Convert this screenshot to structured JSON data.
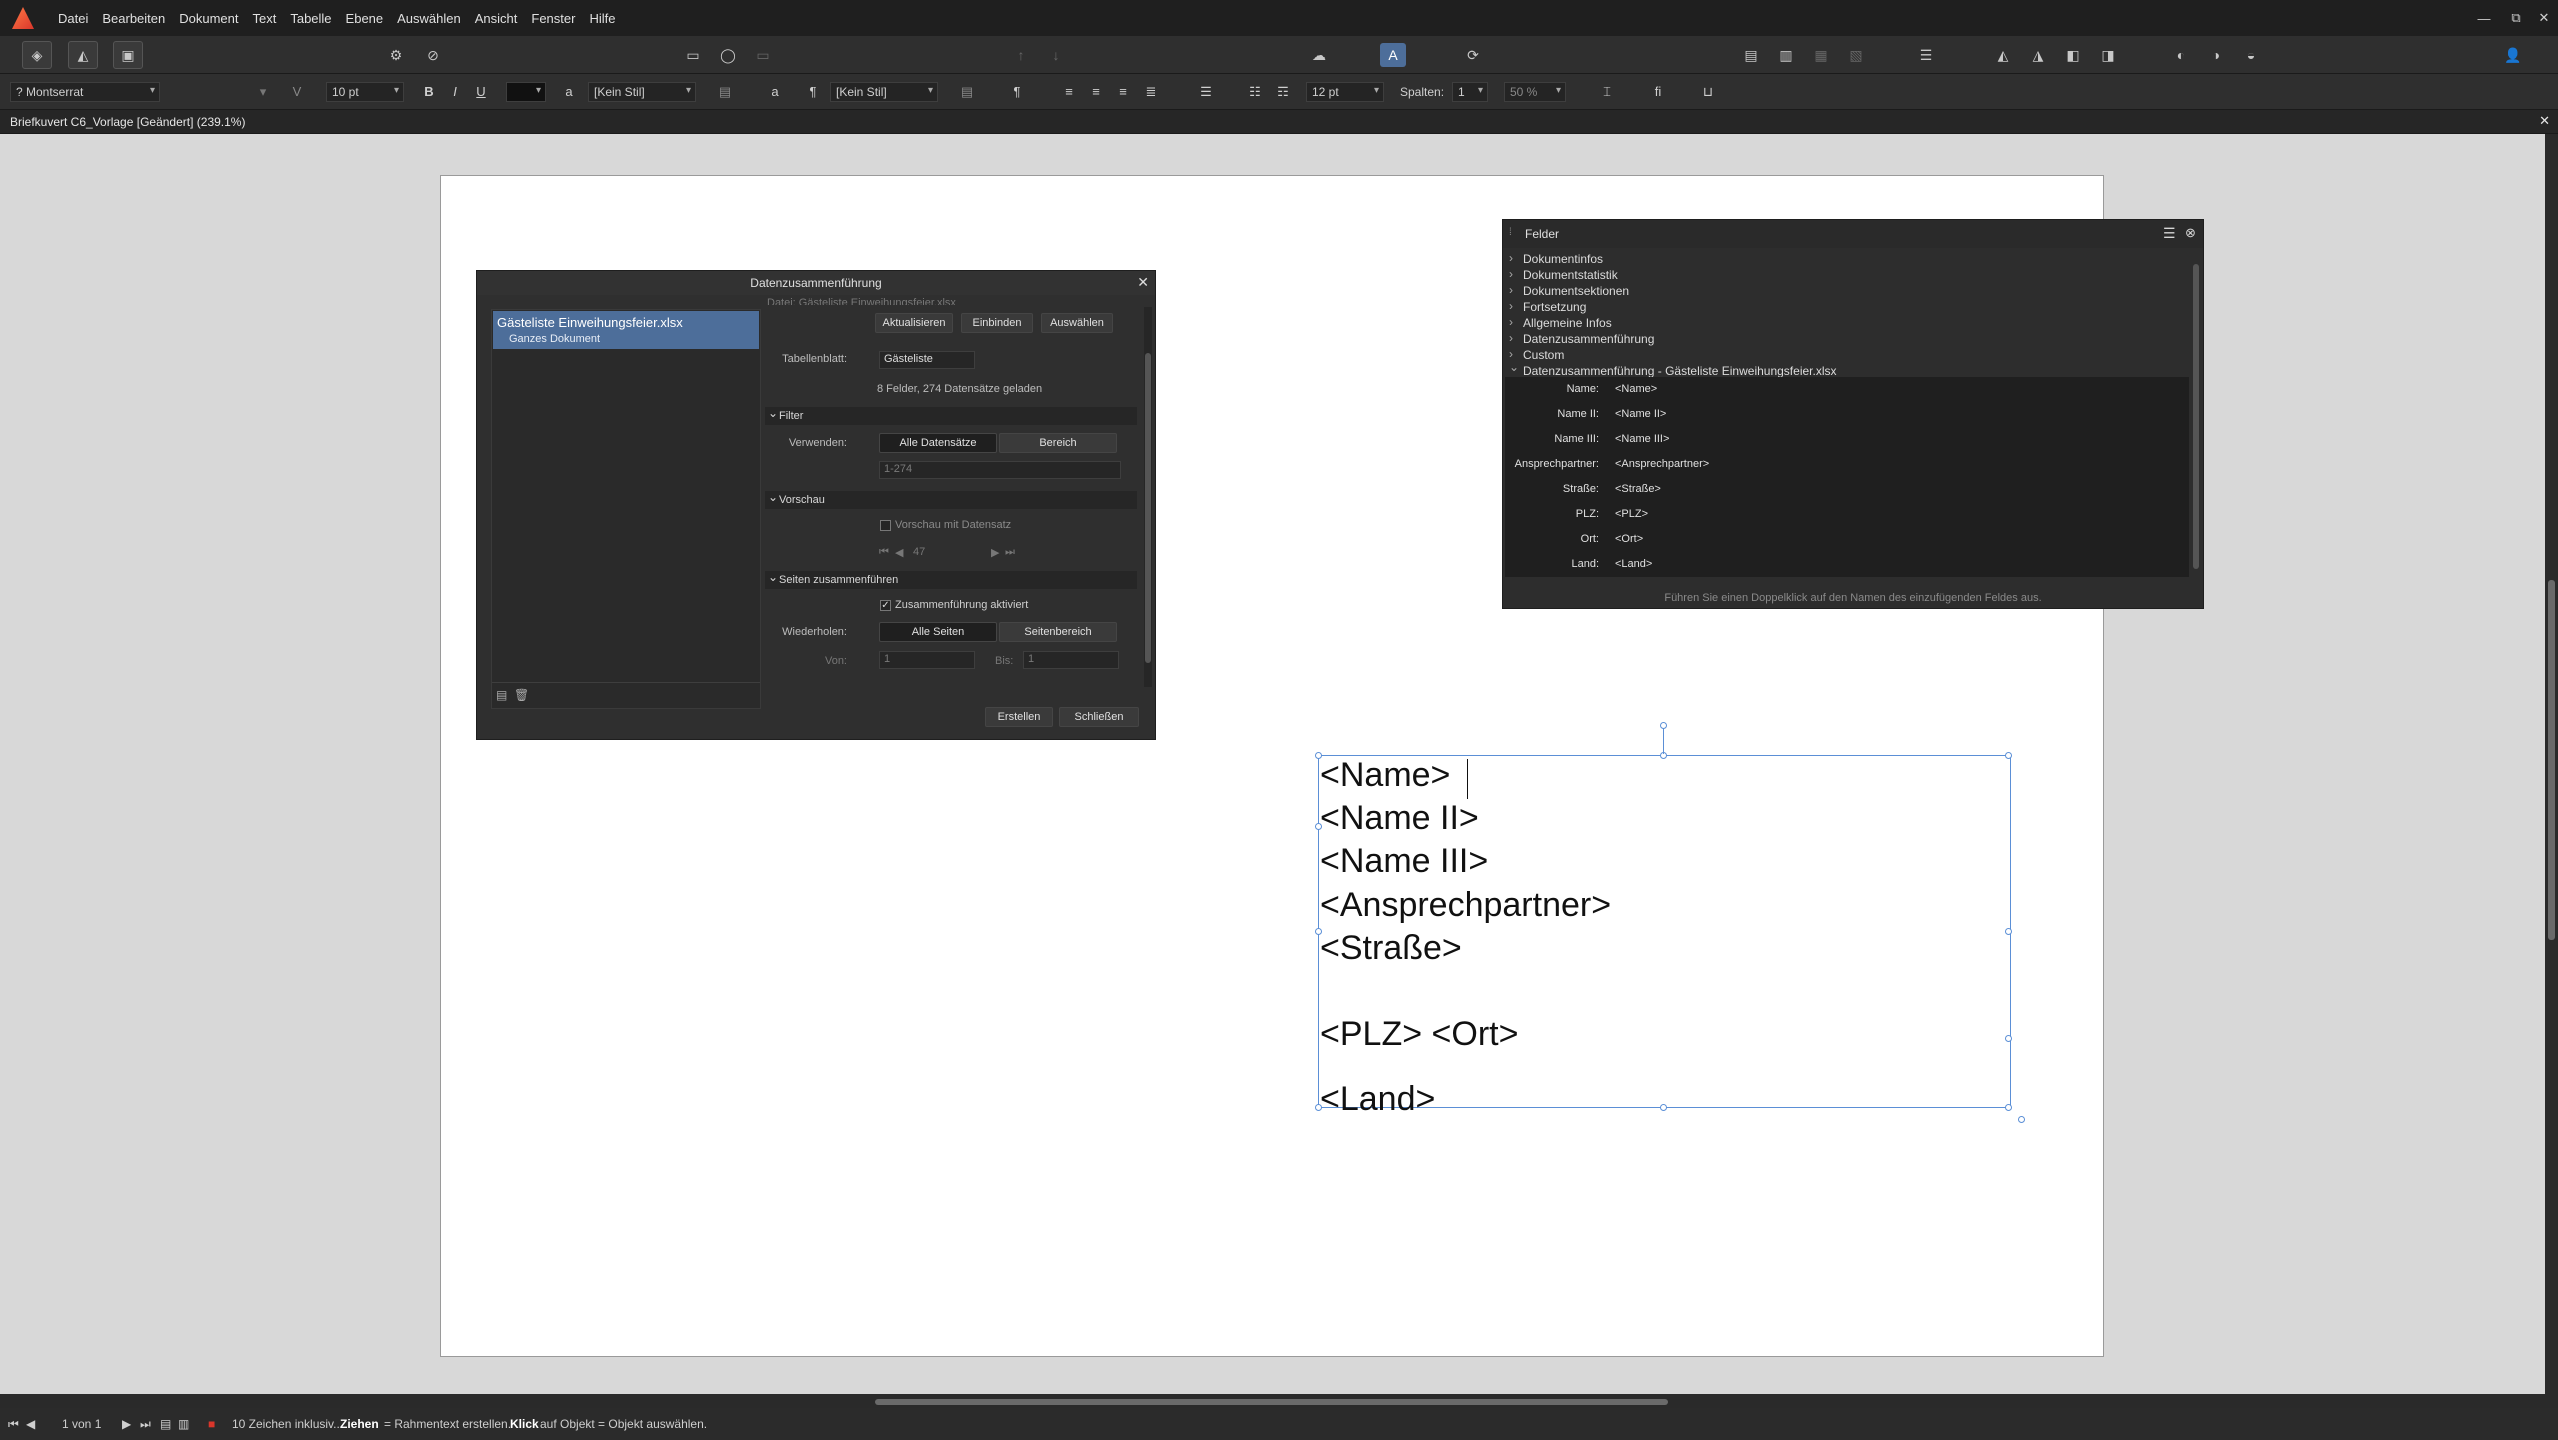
{
  "menu": [
    "Datei",
    "Bearbeiten",
    "Dokument",
    "Text",
    "Tabelle",
    "Ebene",
    "Auswählen",
    "Ansicht",
    "Fenster",
    "Hilfe"
  ],
  "window_controls": [
    "—",
    "⧉",
    "✕"
  ],
  "context": {
    "font": "? Montserrat",
    "size": "10 pt",
    "bold": "B",
    "italic": "I",
    "underline": "U",
    "char_style_prefix": "a",
    "char_style": "[Kein Stil]",
    "para_style_prefix": "¶",
    "para_style": "[Kein Stil]",
    "leading": "12 pt",
    "columns_label": "Spalten:",
    "columns_value": "1",
    "percent": "50 %",
    "ligature": "fi"
  },
  "doc_tab": "Briefkuvert C6_Vorlage [Geändert] (239.1%)",
  "textframe": {
    "lines": [
      "<Name>",
      "<Name II>",
      "<Name III>",
      "<Ansprechpartner>",
      "<Straße>",
      "<PLZ> <Ort>",
      "<Land>"
    ]
  },
  "merge_dialog": {
    "title": "Datenzusammenführung",
    "source_name": "Gästeliste Einweihungsfeier.xlsx",
    "source_scope": "Ganzes Dokument",
    "clipped_label": "Datei: Gästeliste Einweihungsfeier.xlsx",
    "btn_update": "Aktualisieren",
    "btn_embed": "Einbinden",
    "btn_select": "Auswählen",
    "sheet_label": "Tabellenblatt:",
    "sheet_value": "Gästeliste",
    "summary": "8 Felder, 274 Datensätze geladen",
    "filter_header": "Filter",
    "use_label": "Verwenden:",
    "use_all": "Alle Datensätze",
    "use_range": "Bereich",
    "range_value": "1-274",
    "preview_header": "Vorschau",
    "preview_cb": "Vorschau mit Datensatz",
    "preview_nav_first": "⏮",
    "preview_nav_prev": "◀",
    "preview_record": "47",
    "preview_nav_next": "▶",
    "preview_nav_last": "⏭",
    "merge_header": "Seiten zusammenführen",
    "merge_cb": "Zusammenführung aktiviert",
    "repeat_label": "Wiederholen:",
    "repeat_all": "Alle Seiten",
    "repeat_range": "Seitenbereich",
    "from_label": "Von:",
    "from_value": "1",
    "to_label": "Bis:",
    "to_value": "1",
    "btn_create": "Erstellen",
    "btn_close": "Schließen"
  },
  "felder_panel": {
    "title": "Felder",
    "groups": [
      "Dokumentinfos",
      "Dokumentstatistik",
      "Dokumentsektionen",
      "Fortsetzung",
      "Allgemeine Infos",
      "Datenzusammenführung",
      "Custom",
      "Datenzusammenführung - Gästeliste Einweihungsfeier.xlsx"
    ],
    "fields": [
      {
        "label": "Name:",
        "value": "<Name>"
      },
      {
        "label": "Name II:",
        "value": "<Name II>"
      },
      {
        "label": "Name III:",
        "value": "<Name III>"
      },
      {
        "label": "Ansprechpartner:",
        "value": "<Ansprechpartner>"
      },
      {
        "label": "Straße:",
        "value": "<Straße>"
      },
      {
        "label": "PLZ:",
        "value": "<PLZ>"
      },
      {
        "label": "Ort:",
        "value": "<Ort>"
      },
      {
        "label": "Land:",
        "value": "<Land>"
      }
    ],
    "hint": "Führen Sie einen Doppelklick auf den Namen des einzufügenden Feldes aus."
  },
  "status": {
    "page": "1 von 1",
    "message_plain": "10 Zeichen inklusiv...",
    "drag_bold": "Ziehen",
    "drag_text": "= Rahmentext erstellen.",
    "click_bold": "Klick",
    "click_text": "auf Objekt = Objekt auswählen."
  }
}
